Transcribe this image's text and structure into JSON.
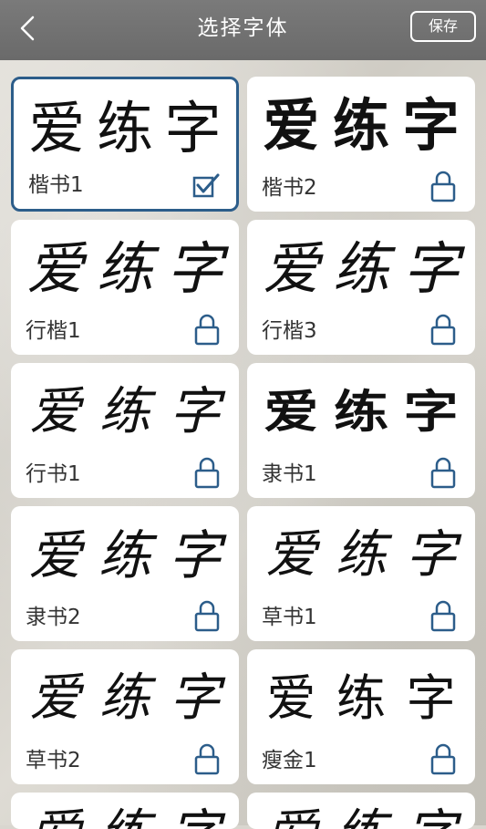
{
  "header": {
    "title": "选择字体",
    "save_label": "保存"
  },
  "sample_chars": [
    "爱",
    "练",
    "字"
  ],
  "fonts": [
    {
      "label": "楷书1",
      "selected": true,
      "locked": false
    },
    {
      "label": "楷书2",
      "selected": false,
      "locked": true
    },
    {
      "label": "行楷1",
      "selected": false,
      "locked": true
    },
    {
      "label": "行楷3",
      "selected": false,
      "locked": true
    },
    {
      "label": "行书1",
      "selected": false,
      "locked": true
    },
    {
      "label": "隶书1",
      "selected": false,
      "locked": true
    },
    {
      "label": "隶书2",
      "selected": false,
      "locked": true
    },
    {
      "label": "草书1",
      "selected": false,
      "locked": true
    },
    {
      "label": "草书2",
      "selected": false,
      "locked": true
    },
    {
      "label": "瘦金1",
      "selected": false,
      "locked": true
    }
  ],
  "colors": {
    "accent": "#2c5d8a",
    "header_bg": "#6f6f6f",
    "card_bg": "#ffffff"
  },
  "icons": {
    "back": "chevron-left-icon",
    "lock": "lock-icon",
    "check": "checkbox-checked-icon"
  }
}
